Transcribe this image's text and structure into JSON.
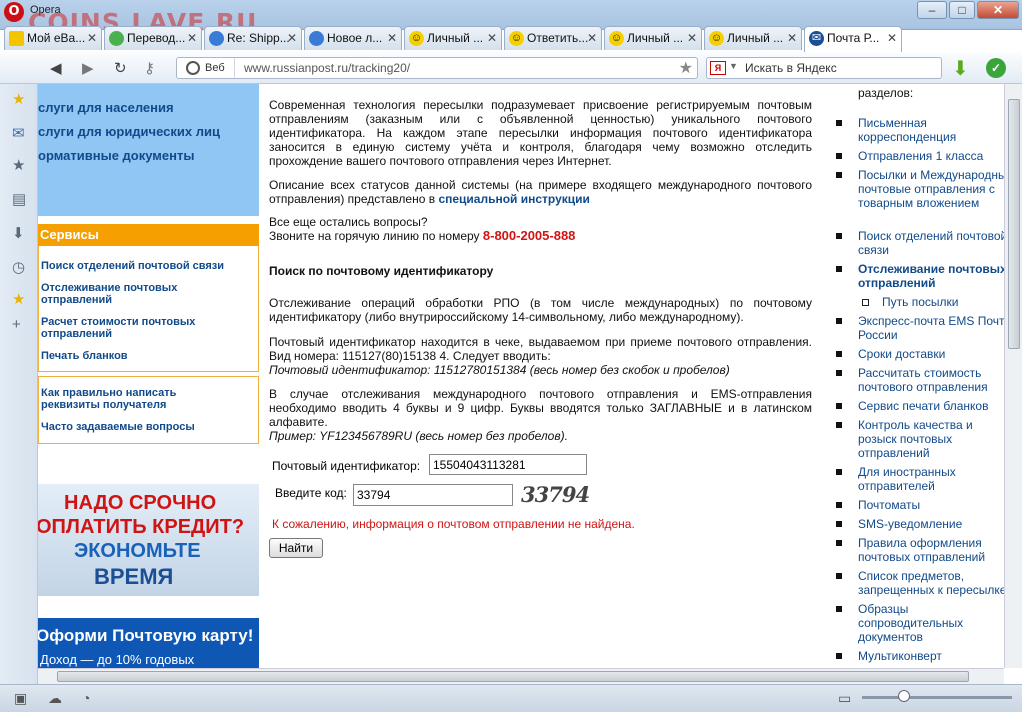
{
  "window": {
    "app_name": "Opera",
    "watermark": "COINS.LAVE.RU",
    "controls": {
      "minimize": "–",
      "maximize": "□",
      "close": "✕"
    }
  },
  "tabs": [
    {
      "label": "Мой еВа...",
      "icon": "ebay-icon",
      "active": false
    },
    {
      "label": "Перевод...",
      "icon": "translate-icon",
      "active": false
    },
    {
      "label": "Re: Shipp...",
      "icon": "opera-icon",
      "active": false
    },
    {
      "label": "Новое л...",
      "icon": "opera-icon",
      "active": false
    },
    {
      "label": "Личный ...",
      "icon": "smiley-icon",
      "active": false
    },
    {
      "label": "Ответить...",
      "icon": "smiley-icon",
      "active": false
    },
    {
      "label": "Личный ...",
      "icon": "smiley-icon",
      "active": false
    },
    {
      "label": "Личный ...",
      "icon": "smiley-icon",
      "active": false
    },
    {
      "label": "Почта Р...",
      "icon": "russianpost-icon",
      "active": true
    }
  ],
  "toolbar": {
    "web_label": "Веб",
    "url": "www.russianpost.ru/tracking20/",
    "search_placeholder": "Искать в Яндекс",
    "search_engine": "Я"
  },
  "left_nav": {
    "top_links": [
      "слуги для населения",
      "слуги для юридических лиц",
      "ормативные документы"
    ],
    "services_title": "Сервисы",
    "services": [
      "Поиск отделений почтовой связи",
      "Отслеживание почтовых отправлений",
      "Расчет стоимости почтовых отправлений",
      "Печать бланков"
    ],
    "help": [
      "Как правильно написать реквизиты получателя",
      "Часто задаваемые вопросы"
    ]
  },
  "banner1": {
    "line1": "НАДО СРОЧНО",
    "line2": "ОПЛАТИТЬ КРЕДИТ?",
    "line3": "ЭКОНОМЬТЕ",
    "line4": "ВРЕМЯ"
  },
  "banner2": {
    "line1": "Оформи Почтовую карту!",
    "line2": "Доход — до 10% годовых"
  },
  "main": {
    "intro": "Современная технология пересылки подразумевает присвоение регистрируемым почтовым отправлениям (заказным или с объявленной ценностью) уникального почтового идентификатора. На каждом этапе пересылки информация почтового идентификатора заносится в единую систему учёта и контроля, благодаря чему возможно отследить прохождение вашего почтового отправления через Интернет.",
    "statuses_text": "Описание всех статусов данной системы (на примере входящего международного почтового отправления) представлено в",
    "statuses_link": "специальной инструкции",
    "questions": "Все еще остались вопросы?",
    "hotline_text": "Звоните на горячую линию по номеру",
    "hotline_number": "8-800-2005-888",
    "section_title": "Поиск по почтовому идентификатору",
    "tracking_text": "Отслеживание операций обработки РПО (в том числе международных) по почтовому идентификатору (либо внутрироссийскому 14-символьному, либо международному).",
    "receipt_text": "Почтовый идентификатор находится в чеке, выдаваемом при приеме почтового отправления. Вид номера: 115127(80)15138 4. Следует вводить:",
    "receipt_example": "Почтовый идентификатор: 11512780151384 (весь номер без скобок и пробелов)",
    "ems_text": "В случае отслеживания международного почтового отправления и EMS-отправления необходимо вводить 4 буквы и 9 цифр. Буквы вводятся только ЗАГЛАВНЫЕ и в латинском алфавите.",
    "ems_example": "Пример: YF123456789RU (весь номер без пробелов).",
    "form": {
      "id_label": "Почтовый идентификатор:",
      "id_value": "15504043113281",
      "code_label": "Введите код:",
      "code_value": "33794",
      "captcha": "33794",
      "error": "К сожалению, информация о почтовом отправлении не найдена.",
      "submit": "Найти"
    }
  },
  "right_nav": {
    "header": "разделов:",
    "items": [
      {
        "label": "Письменная корреспонденция"
      },
      {
        "label": "Отправления 1 класса"
      },
      {
        "label": "Посылки и Международные почтовые отправления с товарным вложением"
      },
      {
        "label": "Поиск отделений почтовой связи"
      },
      {
        "label": "Отслеживание почтовых отправлений"
      },
      {
        "label": "Путь посылки"
      },
      {
        "label": "Экспресс-почта EMS Почта России"
      },
      {
        "label": "Сроки доставки"
      },
      {
        "label": "Рассчитать стоимость почтового отправления"
      },
      {
        "label": "Сервис печати бланков"
      },
      {
        "label": "Контроль качества и розыск почтовых отправлений"
      },
      {
        "label": "Для иностранных отправителей"
      },
      {
        "label": "Почтоматы"
      },
      {
        "label": "SMS-уведомление"
      },
      {
        "label": "Правила оформления почтовых отправлений"
      },
      {
        "label": "Список предметов, запрещенных к пересылке"
      },
      {
        "label": "Образцы сопроводительных документов"
      },
      {
        "label": "Мультиконверт"
      }
    ]
  },
  "colors": {
    "accent_orange": "#f5a000",
    "link_blue": "#114a8a",
    "error_red": "#d01414",
    "nav_bg": "#90c6f4"
  }
}
